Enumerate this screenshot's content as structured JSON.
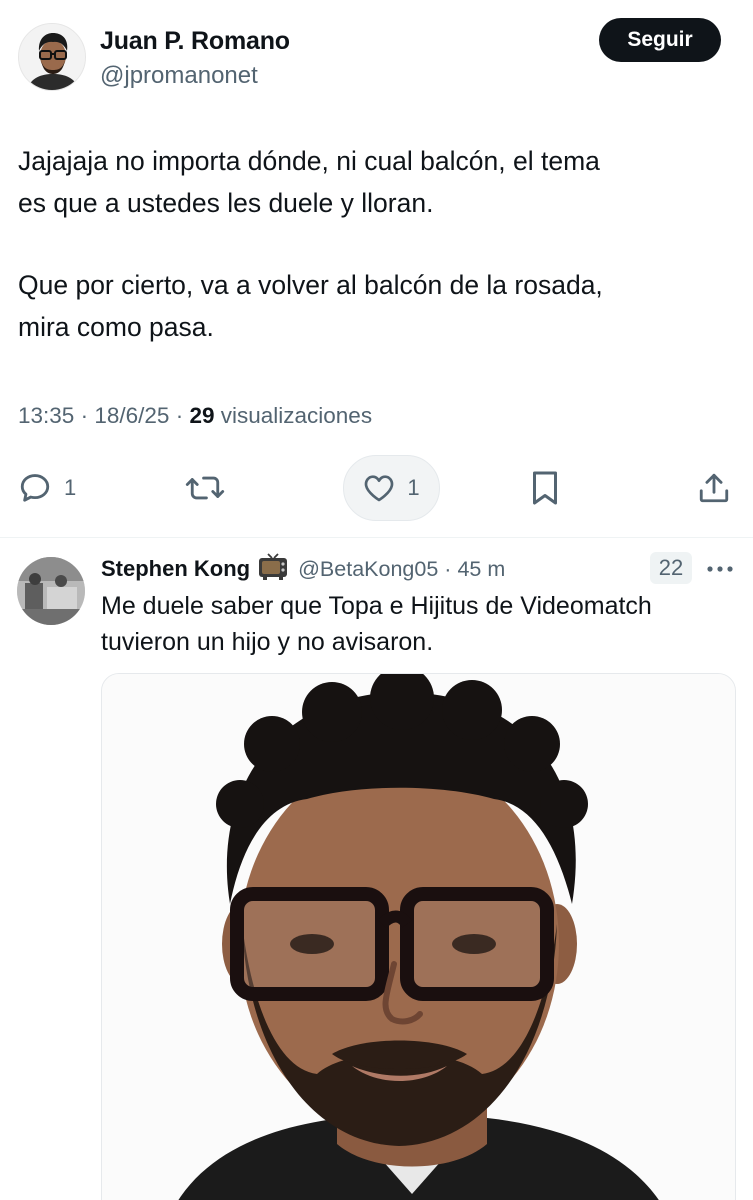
{
  "main_tweet": {
    "author": {
      "name": "Juan P. Romano",
      "handle": "@jpromanonet"
    },
    "follow_label": "Seguir",
    "text": {
      "paragraph1_line1": "Jajajaja no importa dónde, ni cual balcón, el tema",
      "paragraph1_line2": "es que a ustedes les duele y lloran.",
      "paragraph2_line1": "Que por cierto, va a volver al balcón de la rosada,",
      "paragraph2_line2": "mira como pasa."
    },
    "meta": {
      "time": "13:35",
      "date": "18/6/25",
      "views_count": "29",
      "views_label": "visualizaciones",
      "separator": "·"
    },
    "actions": {
      "reply_count": "1",
      "like_count": "1"
    }
  },
  "reply_tweet": {
    "author": {
      "name": "Stephen Kong",
      "handle": "@BetaKong05"
    },
    "separator": "·",
    "time": "45 m",
    "badge": "22",
    "text": {
      "line1": "Me duele saber que Topa e Hijitus de Videomatch",
      "line2": "tuvieron un hijo y no avisaron."
    }
  },
  "icons": {
    "reply": "speech-bubble-icon",
    "retweet": "retweet-icon",
    "like": "heart-icon",
    "bookmark": "bookmark-icon",
    "share": "share-upload-icon",
    "more": "more-dots-icon",
    "badge": "television-emoji-icon"
  },
  "colors": {
    "text_primary": "#0f1419",
    "text_secondary": "#536471",
    "follow_button_bg": "#0f1419",
    "divider": "#eff3f4"
  }
}
